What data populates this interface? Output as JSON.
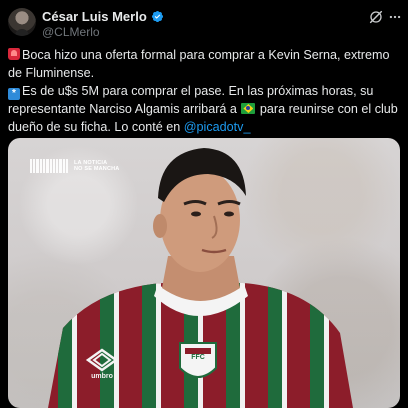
{
  "author": {
    "name": "César Luis Merlo",
    "handle": "@CLMerlo"
  },
  "tweet": {
    "line1": "Boca hizo una oferta formal para comprar a Kevin Serna, extremo de Fluminense.",
    "line2_a": "Es de u$s 5M para comprar el pase. En las próximas horas, su representante Narciso Algamis arribará a ",
    "line2_b": " para reunirse con el club dueño de su ficha. Lo conté en ",
    "mention": "@picadotv_"
  },
  "media": {
    "watermark_line1": "LA NOTICIA",
    "watermark_line2": "NO SE MANCHA",
    "crest_label": "FFC",
    "sponsor_label": "umbro"
  },
  "icons": {
    "verified": "verified-badge-icon",
    "grok": "grok-icon",
    "more": "more-options-icon",
    "emoji1": "alarm-light-emoji",
    "emoji2": "asterisk-emoji",
    "emoji3": "brazil-flag-emoji"
  },
  "colors": {
    "background": "#000000",
    "text": "#e7e9ea",
    "secondary": "#71767b",
    "link": "#1d9bf0",
    "jersey_red": "#8c1d2a",
    "jersey_green": "#1f6b3c"
  }
}
